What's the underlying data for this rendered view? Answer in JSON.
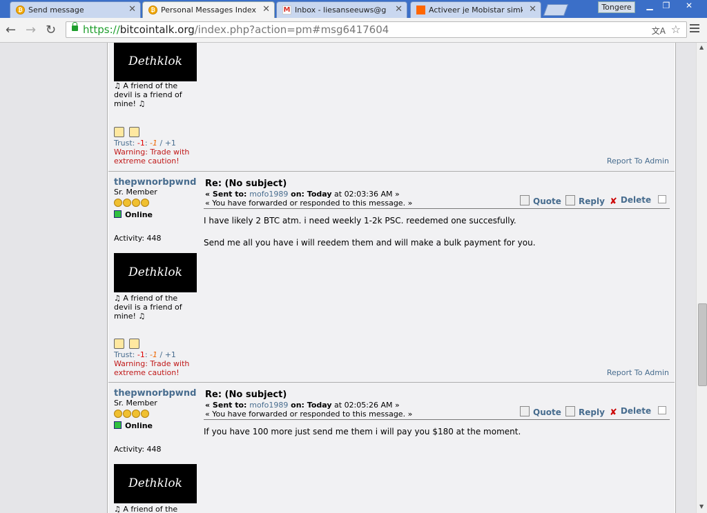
{
  "browser": {
    "tabs": [
      {
        "title": "Send message",
        "icon": "bitcoin-icon",
        "active": false
      },
      {
        "title": "Personal Messages Index",
        "icon": "bitcoin-icon",
        "active": true
      },
      {
        "title": "Inbox - liesanseeuws@gmail",
        "icon": "gmail-icon",
        "active": false
      },
      {
        "title": "Activeer je Mobistar simkaart",
        "icon": "orange-icon",
        "active": false
      }
    ],
    "profile_label": "Tongere",
    "url_scheme": "https://",
    "url_domain": "bitcointalk.org",
    "url_path": "/index.php?action=pm#msg6417604"
  },
  "signature": {
    "avatar_text": "Dethklok",
    "sig_text": "♫ A friend of the devil is a friend of mine! ♫",
    "trust_label": "Trust: ",
    "trust_neg": "-1",
    "trust_sep": ": ",
    "trust_mid": "-1",
    "trust_slash": " / ",
    "trust_pos": "+1",
    "warning": "Warning: Trade with extreme caution!",
    "report": "Report To Admin"
  },
  "author": {
    "name": "thepwnorbpwnd",
    "rank": "Sr. Member",
    "status": "Online",
    "activity": "Activity: 448"
  },
  "actions": {
    "quote": "Quote",
    "reply": "Reply",
    "delete": "Delete"
  },
  "messages": [
    {
      "subject": "Re: (No subject)",
      "sent_prefix": "« Sent to: ",
      "recipient": "mofo1989",
      "on_label": " on: ",
      "date_bold": "Today",
      "time": " at 02:03:36 AM »",
      "forwarded": "« You have forwarded or responded to this message. »",
      "body": [
        "I have likely 2 BTC atm. i need weekly 1-2k PSC. reedemed one succesfully.",
        "Send me all you have i will reedem them and will make a bulk payment for you."
      ]
    },
    {
      "subject": "Re: (No subject)",
      "sent_prefix": "« Sent to: ",
      "recipient": "mofo1989",
      "on_label": " on: ",
      "date_bold": "Today",
      "time": " at 02:05:26 AM »",
      "forwarded": "« You have forwarded or responded to this message. »",
      "body": [
        "If you have 100 more just send me them i will pay you $180 at the moment."
      ]
    }
  ],
  "colors": {
    "link": "#476c8e",
    "warning": "#c01818",
    "tab_strip": "#3b6fc8"
  }
}
